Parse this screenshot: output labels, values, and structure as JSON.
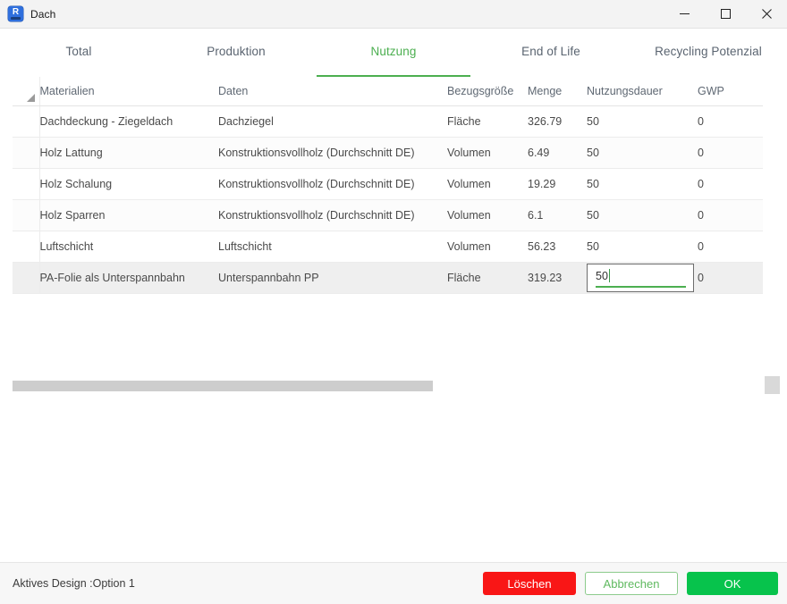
{
  "window": {
    "title": "Dach",
    "icon": "revit-app-icon",
    "controls": {
      "minimize": "minimize-icon",
      "maximize": "maximize-icon",
      "close": "close-icon"
    }
  },
  "tabs": [
    {
      "label": "Total",
      "active": false
    },
    {
      "label": "Produktion",
      "active": false
    },
    {
      "label": "Nutzung",
      "active": true
    },
    {
      "label": "End of Life",
      "active": false
    },
    {
      "label": "Recycling Potenzial",
      "active": false
    }
  ],
  "table": {
    "columns": [
      "Materialien",
      "Daten",
      "Bezugsgröße",
      "Menge",
      "Nutzungsdauer",
      "GWP"
    ],
    "rows": [
      {
        "materialien": "Dachdeckung - Ziegeldach",
        "daten": "Dachziegel",
        "bezugsgroesse": "Fläche",
        "menge": "326.79",
        "nutzungsdauer": "50",
        "gwp": "0"
      },
      {
        "materialien": "Holz Lattung",
        "daten": "Konstruktionsvollholz (Durchschnitt DE)",
        "bezugsgroesse": "Volumen",
        "menge": "6.49",
        "nutzungsdauer": "50",
        "gwp": "0"
      },
      {
        "materialien": "Holz Schalung",
        "daten": "Konstruktionsvollholz (Durchschnitt DE)",
        "bezugsgroesse": "Volumen",
        "menge": "19.29",
        "nutzungsdauer": "50",
        "gwp": "0"
      },
      {
        "materialien": "Holz Sparren",
        "daten": "Konstruktionsvollholz (Durchschnitt DE)",
        "bezugsgroesse": "Volumen",
        "menge": "6.1",
        "nutzungsdauer": "50",
        "gwp": "0"
      },
      {
        "materialien": "Luftschicht",
        "daten": "Luftschicht",
        "bezugsgroesse": "Volumen",
        "menge": "56.23",
        "nutzungsdauer": "50",
        "gwp": "0"
      },
      {
        "materialien": "PA-Folie als Unterspannbahn",
        "daten": "Unterspannbahn PP",
        "bezugsgroesse": "Fläche",
        "menge": "319.23",
        "nutzungsdauer": "50",
        "gwp": "0"
      }
    ],
    "editing_cell": {
      "row_index": 5,
      "column": "Nutzungsdauer",
      "value": "50"
    }
  },
  "footer": {
    "status": "Aktives Design :Option 1",
    "delete_label": "Löschen",
    "cancel_label": "Abbrechen",
    "ok_label": "OK"
  },
  "colors": {
    "accent_green": "#4caf50",
    "ok_green": "#07c34c",
    "delete_red": "#f91616",
    "titlebar_bg": "#f3f3f3",
    "footer_bg": "#f7f7f7",
    "selected_row_bg": "#efefef"
  }
}
